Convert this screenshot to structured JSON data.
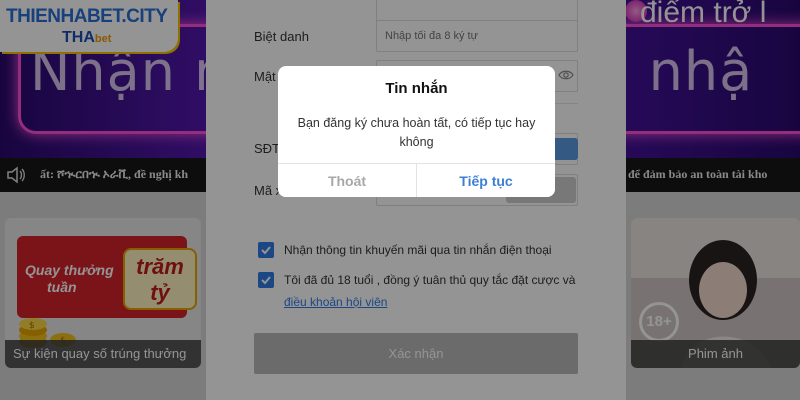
{
  "logo": {
    "brand": "THIENHABET.CITY",
    "sub_main": "THA",
    "sub_suffix": "bet"
  },
  "banner": {
    "big_text": "Nhận n",
    "big_text_right": "nh nhậ",
    "top_text": "điểm trở l"
  },
  "ticker": {
    "left_text": "ất: ሾኊርበኊ ኦራቪ, đề nghị kh",
    "right_text": "để đảm bảo an toàn tài kho"
  },
  "form": {
    "nickname_label": "Biệt danh",
    "nickname_placeholder": "Nhập tối đa 8 ký tự",
    "password_label": "Mật",
    "phone_label": "SĐT",
    "code_label": "Mã x",
    "promo_sms_label": "Nhận thông tin khuyến mãi qua tin nhắn điện thoại",
    "age_terms_label": "Tôi đã đủ 18 tuổi , đồng ý tuân thủ quy tắc đặt cược và",
    "terms_link": "điều khoản hội viên",
    "submit_label": "Xác nhận"
  },
  "cards": {
    "left": {
      "promo_line1": "Quay thưởng",
      "promo_line2": "tuần",
      "promo_big": "trăm tỷ",
      "caption": "Sự kiện quay số trúng thưởng"
    },
    "right": {
      "badge": "18+",
      "caption": "Phim ảnh"
    }
  },
  "modal": {
    "title": "Tin nhắn",
    "message": "Bạn đăng ký chưa hoàn tất, có tiếp tục hay không",
    "cancel_label": "Thoát",
    "confirm_label": "Tiếp tục"
  },
  "colors": {
    "accent": "#3d7fd6",
    "checkbox": "#2f7be5",
    "banner": "#4b14a8",
    "promo_red": "#d3232a"
  }
}
